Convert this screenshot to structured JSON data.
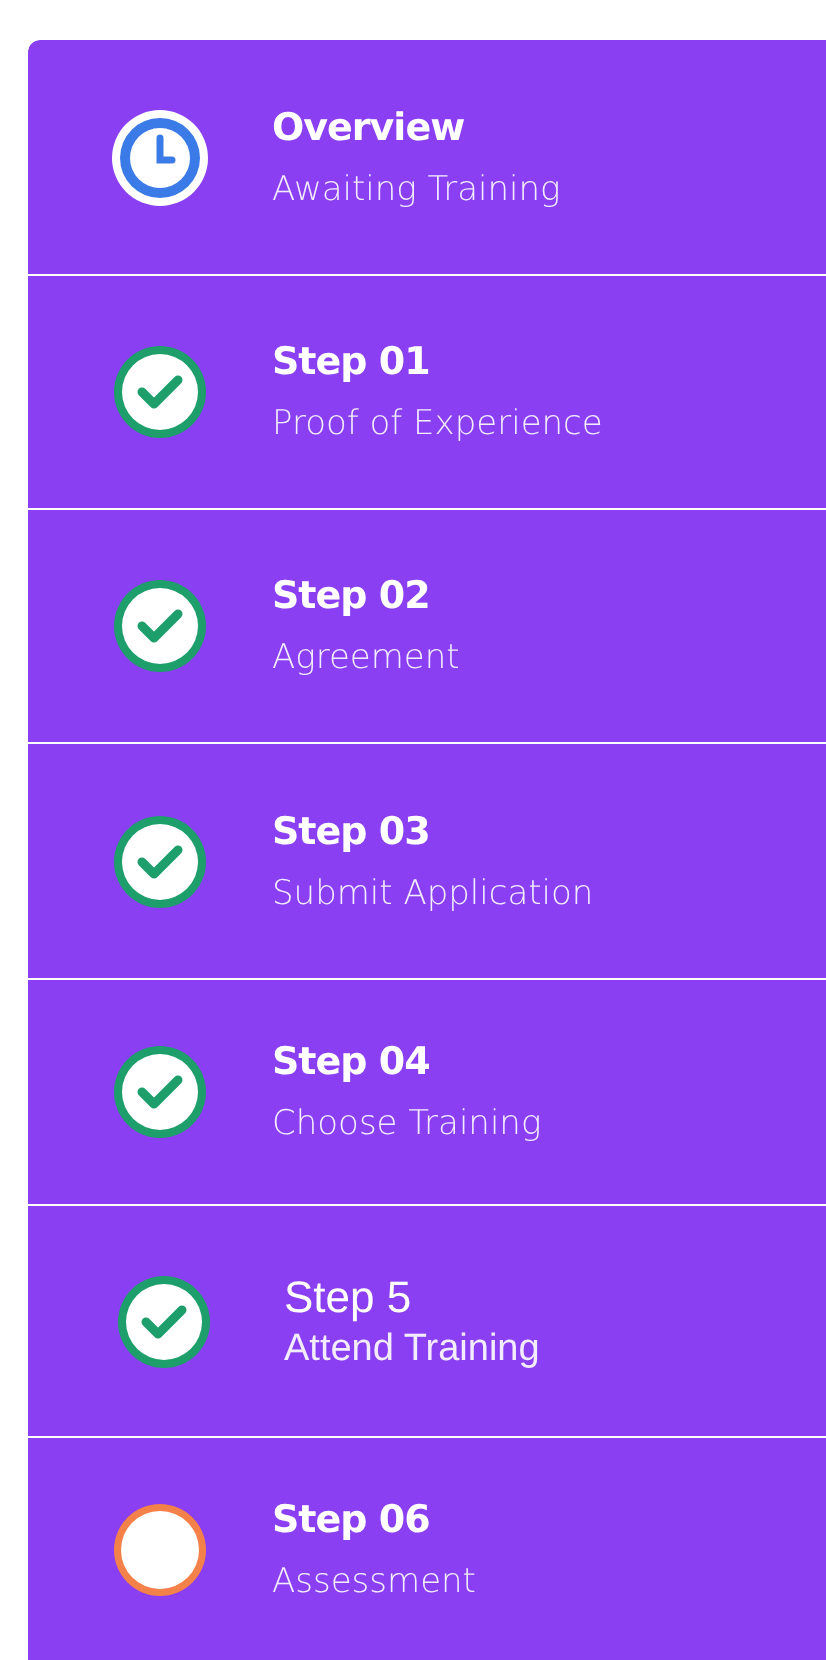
{
  "steps": [
    {
      "title": "Overview",
      "subtitle": "Awaiting Training",
      "kind": "clock",
      "current": false
    },
    {
      "title": "Step 01",
      "subtitle": "Proof of Experience",
      "kind": "done",
      "current": false
    },
    {
      "title": "Step 02",
      "subtitle": "Agreement",
      "kind": "done",
      "current": false
    },
    {
      "title": "Step 03",
      "subtitle": "Submit Application",
      "kind": "done",
      "current": false
    },
    {
      "title": "Step 04",
      "subtitle": "Choose Training",
      "kind": "done",
      "current": false
    },
    {
      "title": "Step 5",
      "subtitle": "Attend Training",
      "kind": "done",
      "current": true
    },
    {
      "title": "Step 06",
      "subtitle": "Assessment",
      "kind": "pending",
      "current": false
    }
  ]
}
